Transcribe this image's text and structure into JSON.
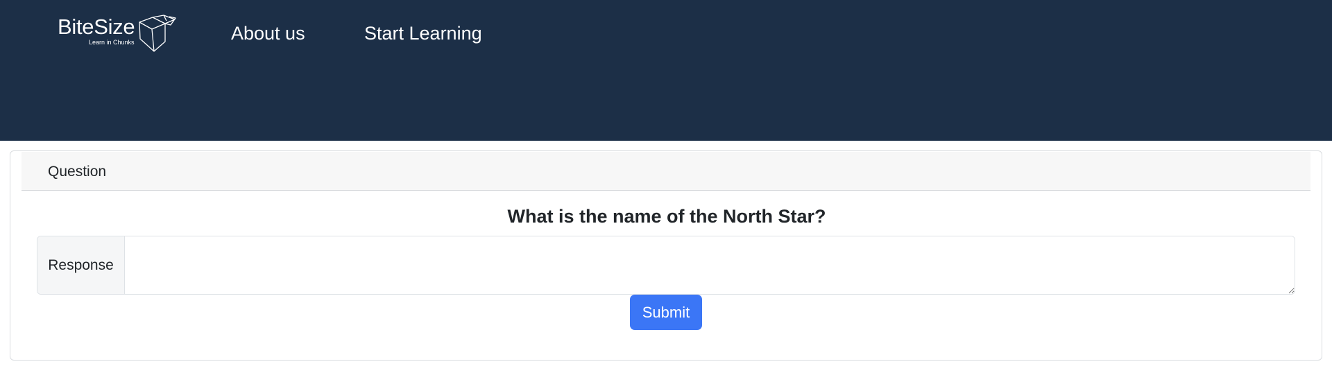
{
  "header": {
    "brand": {
      "name": "BiteSize",
      "tagline": "Learn in Chunks",
      "logo_icon": "open-box-icon"
    },
    "nav_links": [
      {
        "label": "About us"
      },
      {
        "label": "Start Learning"
      }
    ],
    "background_color": "#1c2f47"
  },
  "card": {
    "header_label": "Question",
    "question": "What is the name of the North Star?",
    "response": {
      "label": "Response",
      "value": "",
      "placeholder": ""
    },
    "submit_label": "Submit",
    "submit_color": "#3b76f6"
  }
}
